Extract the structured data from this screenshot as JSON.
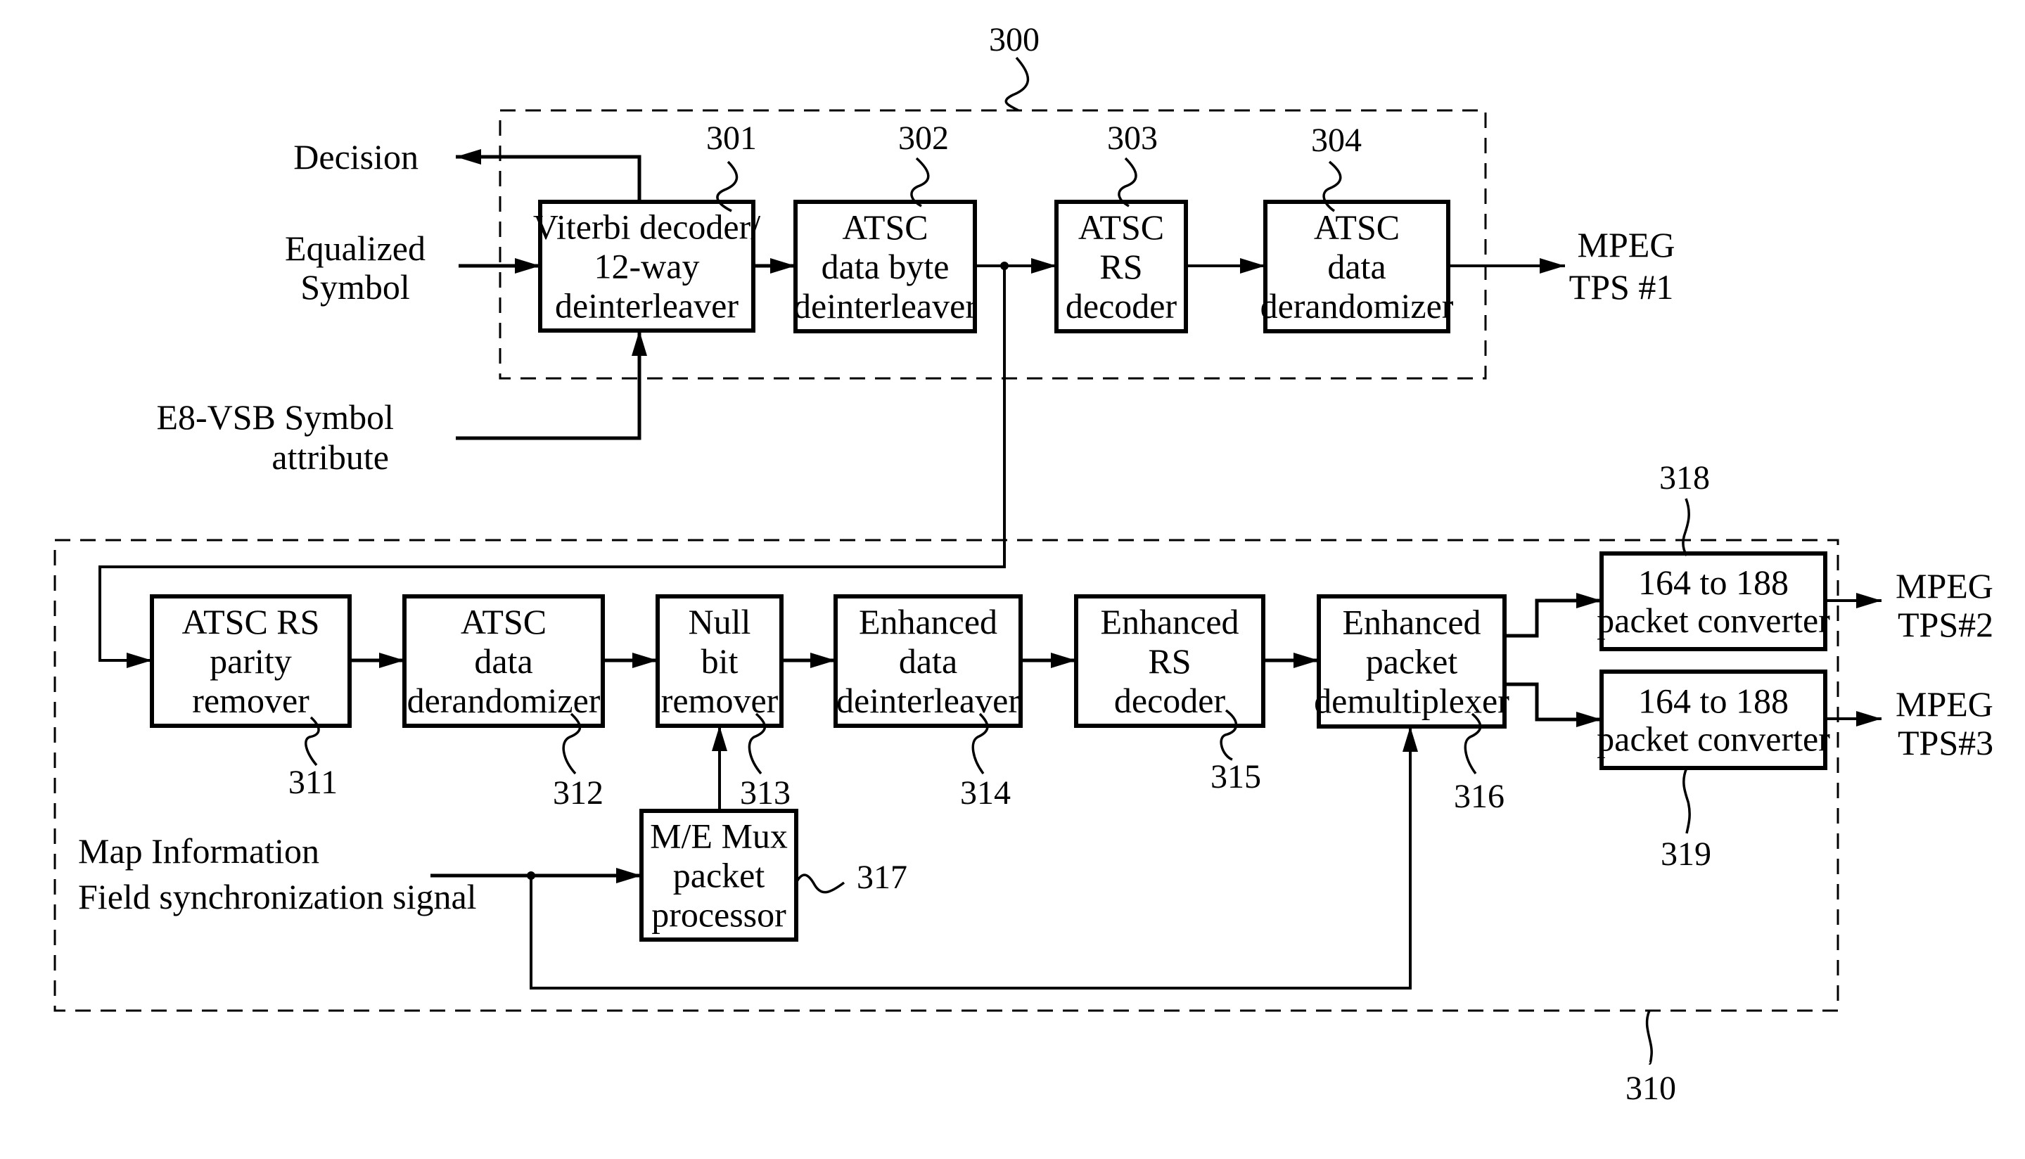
{
  "figure": {
    "groups": [
      {
        "id": "g300",
        "ref": "300"
      },
      {
        "id": "g310",
        "ref": "310"
      }
    ],
    "blocks": [
      {
        "id": "b301",
        "ref": "301",
        "lines": [
          "Viterbi decoder/",
          "12-way",
          "deinterleaver"
        ]
      },
      {
        "id": "b302",
        "ref": "302",
        "lines": [
          "ATSC",
          "data byte",
          "deinterleaver"
        ]
      },
      {
        "id": "b303",
        "ref": "303",
        "lines": [
          "ATSC",
          "RS",
          "decoder"
        ]
      },
      {
        "id": "b304",
        "ref": "304",
        "lines": [
          "ATSC",
          "data",
          "derandomizer"
        ]
      },
      {
        "id": "b311",
        "ref": "311",
        "lines": [
          "ATSC RS",
          "parity",
          "remover"
        ]
      },
      {
        "id": "b312",
        "ref": "312",
        "lines": [
          "ATSC",
          "data",
          "derandomizer"
        ]
      },
      {
        "id": "b313",
        "ref": "313",
        "lines": [
          "Null",
          "bit",
          "remover"
        ]
      },
      {
        "id": "b314",
        "ref": "314",
        "lines": [
          "Enhanced",
          "data",
          "deinterleaver"
        ]
      },
      {
        "id": "b315",
        "ref": "315",
        "lines": [
          "Enhanced",
          "RS",
          "decoder"
        ]
      },
      {
        "id": "b316",
        "ref": "316",
        "lines": [
          "Enhanced",
          "packet",
          "demultiplexer"
        ]
      },
      {
        "id": "b317",
        "ref": "317",
        "lines": [
          "M/E Mux",
          "packet",
          "processor"
        ]
      },
      {
        "id": "b318",
        "ref": "318",
        "lines": [
          "164 to 188",
          "packet converter"
        ]
      },
      {
        "id": "b319",
        "ref": "319",
        "lines": [
          "164 to 188",
          "packet converter"
        ]
      }
    ],
    "signals": {
      "decision": [
        "Decision"
      ],
      "equalized": [
        "Equalized",
        "Symbol"
      ],
      "e8vsb": [
        "E8-VSB Symbol",
        "attribute"
      ],
      "mpeg1": [
        "MPEG",
        "TPS #1"
      ],
      "mpeg2": [
        "MPEG",
        "TPS#2"
      ],
      "mpeg3": [
        "MPEG",
        "TPS#3"
      ],
      "map_info": [
        "Map Information"
      ],
      "field_sync": [
        "Field synchronization signal"
      ]
    }
  }
}
